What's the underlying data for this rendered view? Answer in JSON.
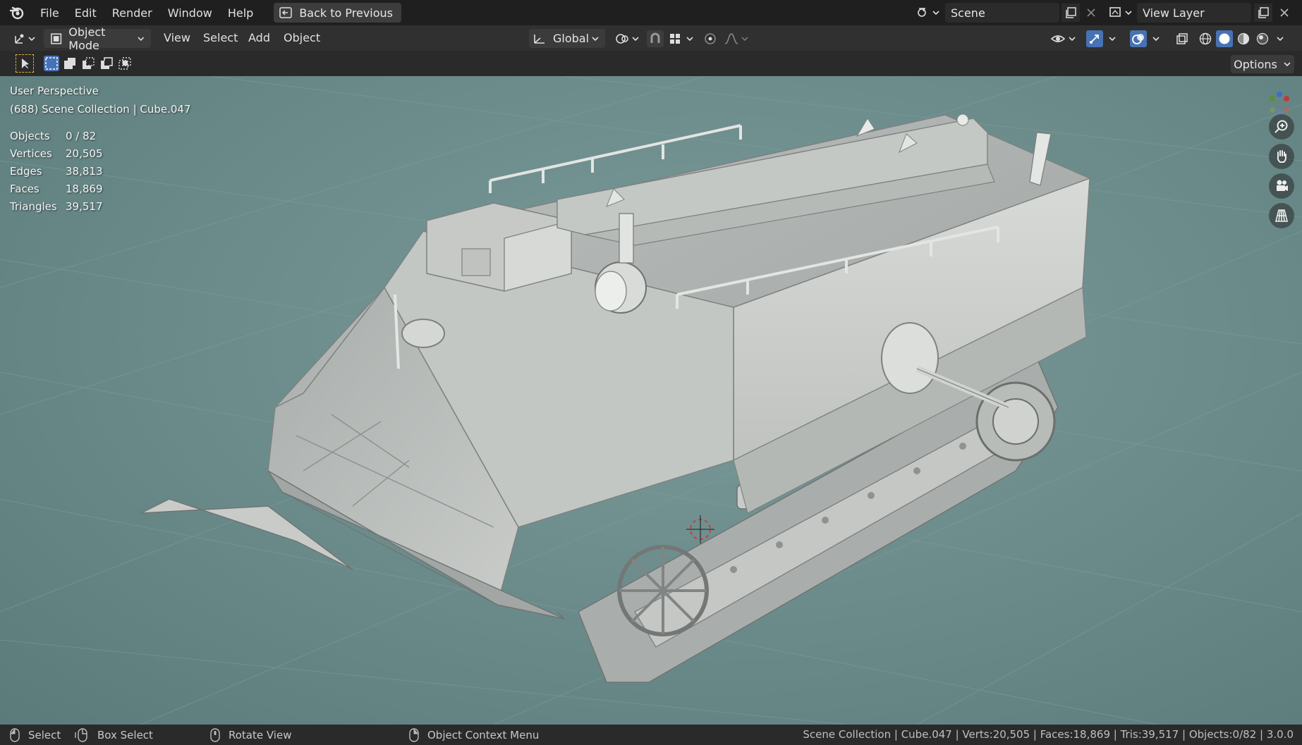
{
  "topbar": {
    "menus": [
      "File",
      "Edit",
      "Render",
      "Window",
      "Help"
    ],
    "back_button": "Back to Previous",
    "scene_name": "Scene",
    "view_layer": "View Layer"
  },
  "header": {
    "mode": "Object Mode",
    "menus": [
      "View",
      "Select",
      "Add",
      "Object"
    ],
    "transform_orientation": "Global"
  },
  "toolbar": {
    "options_label": "Options"
  },
  "viewport": {
    "view_name": "User Perspective",
    "collection_info": "(688) Scene Collection | Cube.047",
    "stats": [
      {
        "label": "Objects",
        "value": "0 / 82"
      },
      {
        "label": "Vertices",
        "value": "20,505"
      },
      {
        "label": "Edges",
        "value": "38,813"
      },
      {
        "label": "Faces",
        "value": "18,869"
      },
      {
        "label": "Triangles",
        "value": "39,517"
      }
    ]
  },
  "statusbar": {
    "select": "Select",
    "box_select": "Box Select",
    "rotate_view": "Rotate View",
    "context_menu": "Object Context Menu",
    "info": "Scene Collection | Cube.047 | Verts:20,505 | Faces:18,869 | Tris:39,517 | Objects:0/82 | 3.0.0"
  },
  "colors": {
    "accent": "#4772b3",
    "viewport_bg": "#6a8a8a",
    "panel": "#303030"
  }
}
